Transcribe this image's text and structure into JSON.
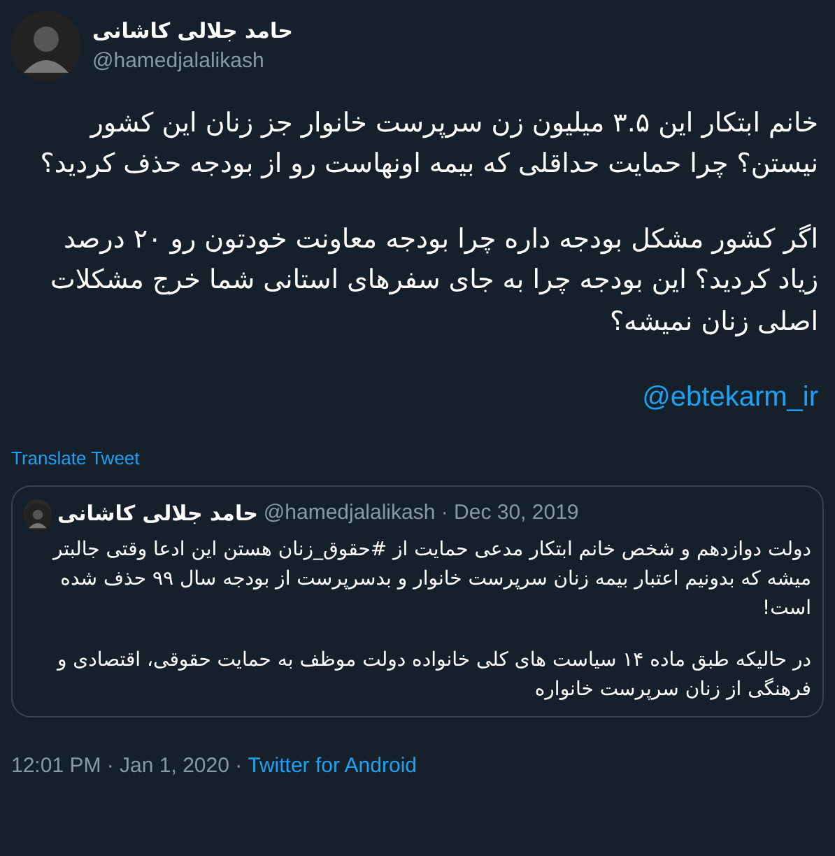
{
  "author": {
    "name": "حامد جلالی کاشانی",
    "handle": "@hamedjalalikash"
  },
  "paragraphs": [
    "خانم ابتکار این ۳.۵ میلیون زن سرپرست خانوار جز زنان این کشور نیستن؟ چرا حمایت حداقلی که بیمه اونهاست رو از بودجه حذف کردید؟",
    "اگر کشور مشکل بودجه داره چرا بودجه معاونت خودتون رو ۲۰ درصد زیاد کردید؟ این بودجه چرا به جای سفرهای استانی شما خرج مشکلات اصلی زنان نمیشه؟"
  ],
  "mention": "@ebtekarm_ir",
  "translate_link": "Translate Tweet",
  "quoted_tweet": {
    "name": "حامد جلالی کاشانی",
    "handle_date": "@hamedjalalikash · Dec 30, 2019",
    "paragraphs": [
      "دولت دوازدهم و شخص خانم ابتکار مدعی حمایت از #حقوق_زنان هستن این ادعا وقتی جالبتر میشه که بدونیم اعتبار بیمه زنان سرپرست خانوار و بدسرپرست از بودجه سال ۹۹ حذف شده است!",
      "در حالیکه طبق ماده ۱۴ سیاست های کلی خانواده دولت موظف به حمایت حقوقی، اقتصادی و فرهنگی از زنان سرپرست خانواره"
    ]
  },
  "meta": {
    "timestamp": "12:01 PM · Jan 1, 2020 ·",
    "source": "Twitter for Android"
  }
}
